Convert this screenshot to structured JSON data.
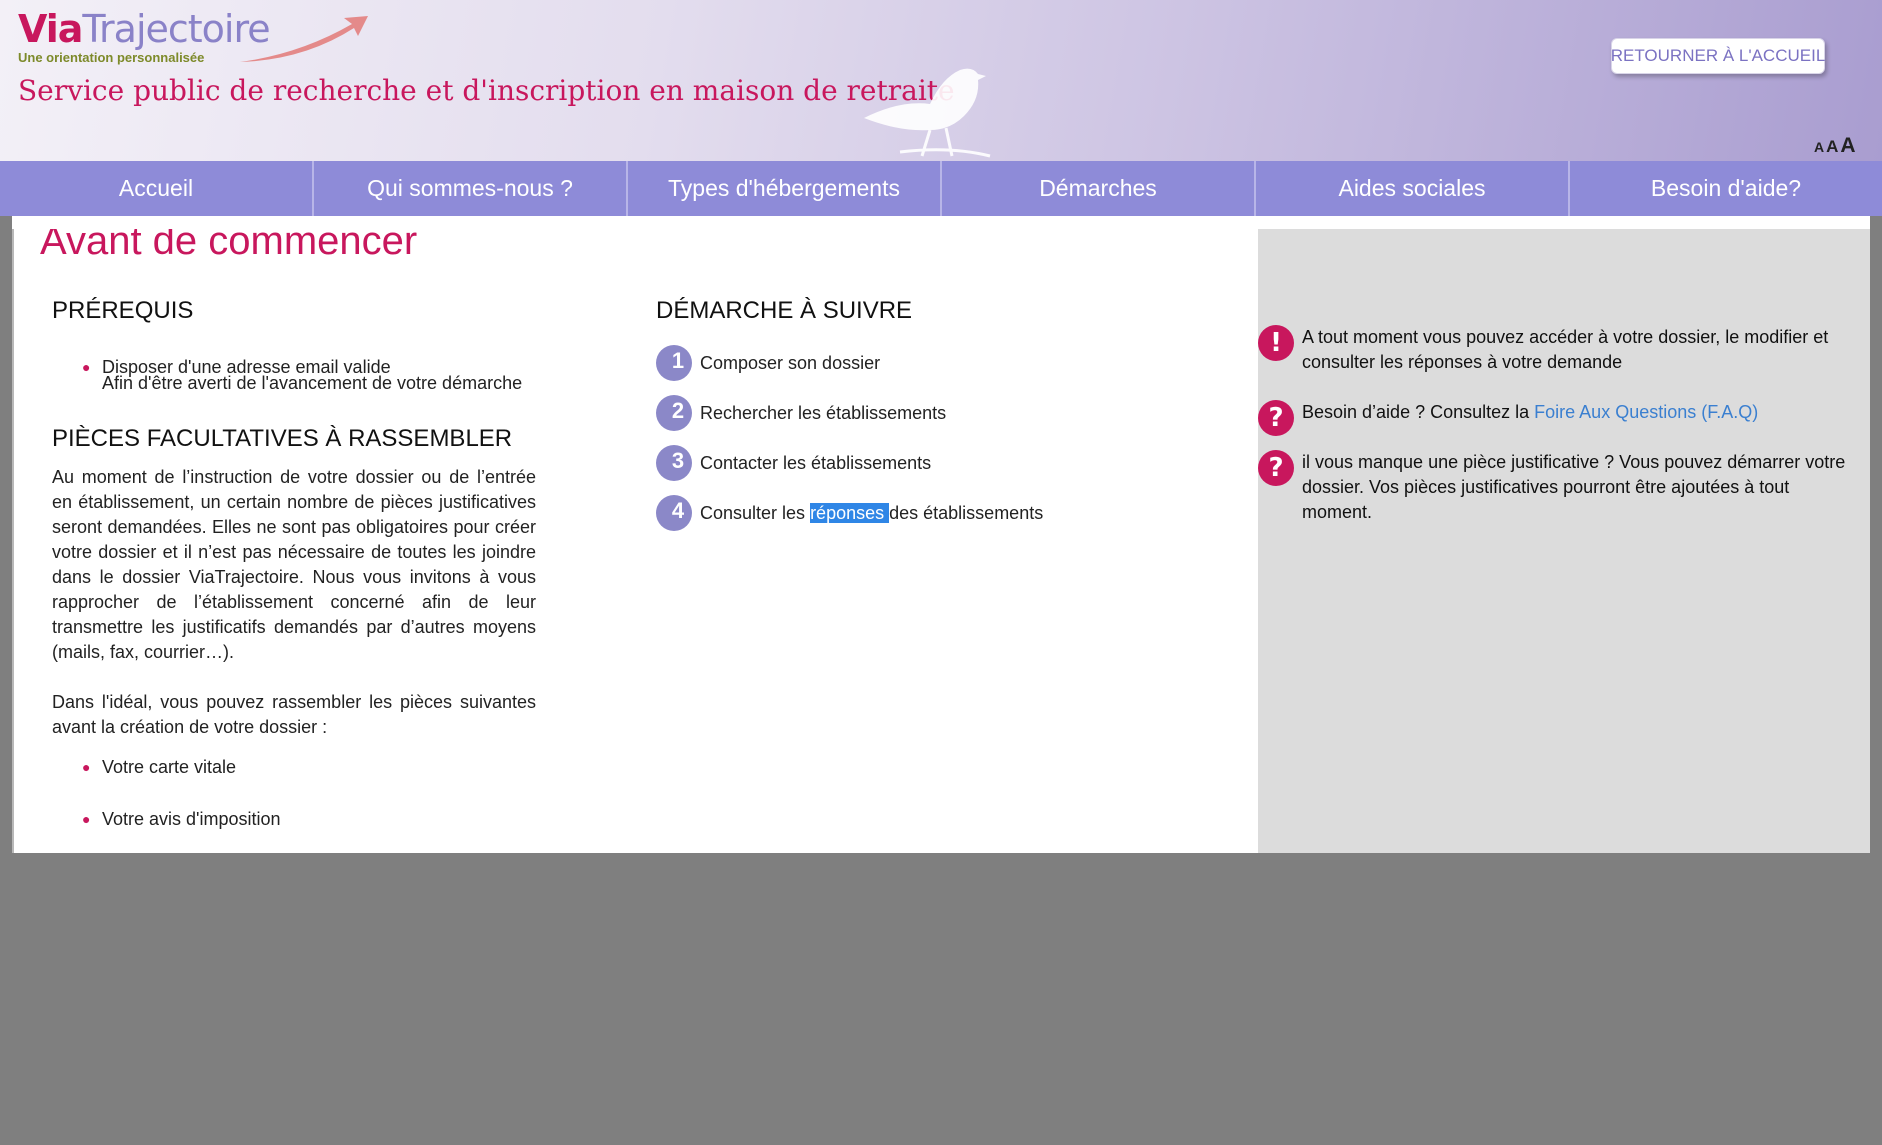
{
  "header": {
    "logo": {
      "via": "Via",
      "trajectoire": "Trajectoire",
      "tagline": "Une orientation personnalisée"
    },
    "service_title": "Service public de recherche et d'inscription en maison de retraite",
    "home_button": "RETOURNER À L'ACCUEIL",
    "font_size_controls": [
      "A",
      "A",
      "A"
    ]
  },
  "nav": {
    "items": [
      {
        "label": "Accueil"
      },
      {
        "label": "Qui sommes-nous ?"
      },
      {
        "label": "Types d'hébergements"
      },
      {
        "label": "Démarches"
      },
      {
        "label": "Aides sociales"
      },
      {
        "label": "Besoin d'aide?"
      }
    ]
  },
  "main": {
    "page_title": "Avant de commencer",
    "prerequisites": {
      "heading": "PRÉREQUIS",
      "items": [
        {
          "text": "Disposer d'une adresse email valide",
          "sub": "Afin d'être averti de l'avancement de votre démarche"
        }
      ]
    },
    "optional_docs": {
      "heading": "PIÈCES FACULTATIVES À RASSEMBLER",
      "para1": "Au moment de l’instruction de votre dossier ou de l’entrée en établissement, un certain nombre de pièces justificatives seront demandées. Elles ne sont pas obligatoires pour créer votre dossier et il n’est pas nécessaire de toutes les joindre dans le dossier ViaTrajectoire. Nous vous invitons à vous rapprocher de l’établissement concerné afin de leur transmettre les justificatifs demandés par d’autres moyens (mails, fax, courrier…).",
      "para2": "Dans l'idéal, vous pouvez rassembler les pièces suivantes avant la création de votre dossier :",
      "items": [
        "Votre carte vitale",
        "Votre avis d'imposition"
      ]
    },
    "steps": {
      "heading": "DÉMARCHE À SUIVRE",
      "items": [
        {
          "num": "1",
          "text": "Composer son dossier"
        },
        {
          "num": "2",
          "text": "Rechercher les établissements"
        },
        {
          "num": "3",
          "text": "Contacter les établissements"
        },
        {
          "num": "4",
          "pre": "Consulter les ",
          "highlight": "réponses ",
          "post": "des établissements"
        }
      ]
    }
  },
  "side": {
    "notes": [
      {
        "icon": "!",
        "text": "A tout moment vous pouvez accéder à votre dossier, le modifier et consulter les réponses à votre demande"
      },
      {
        "icon": "?",
        "pre": "Besoin d’aide ? Consultez la ",
        "link": "Foire Aux Questions (F.A.Q)"
      },
      {
        "icon": "?",
        "text": "il vous manque une pièce justificative ? Vous pouvez démarrer votre dossier. Vos pièces justificatives pourront être ajoutées à tout moment."
      }
    ]
  },
  "colors": {
    "brand": "#c8175d",
    "nav": "#8e8bd8",
    "accent": "#8b88c8",
    "link": "#3a7fd0"
  }
}
